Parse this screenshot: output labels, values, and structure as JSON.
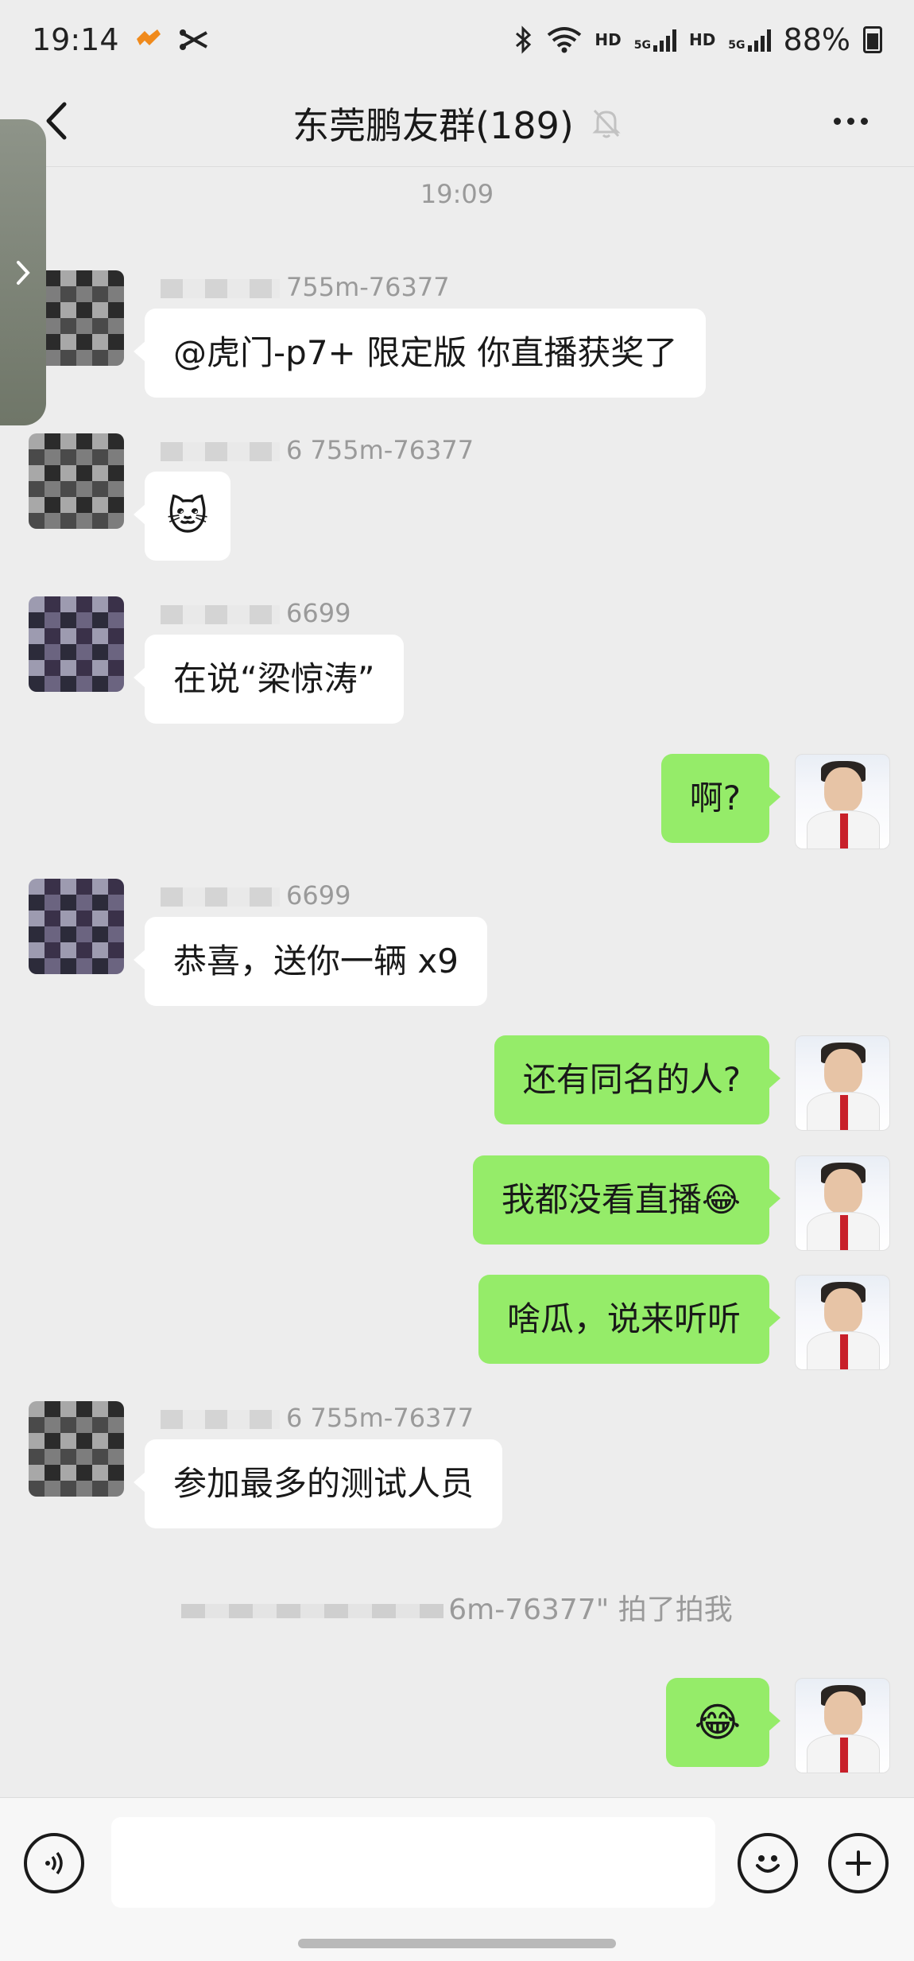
{
  "status_bar": {
    "time": "19:14",
    "network_1": "HD",
    "gen_1": "5G",
    "network_2": "HD",
    "gen_2": "5G",
    "battery": "88%",
    "icons": [
      "bluetooth-icon",
      "wifi-icon",
      "signal-icon",
      "battery-icon"
    ]
  },
  "header": {
    "title": "东莞鹏友群(189)",
    "back_icon": "chevron-left-icon",
    "mute_icon": "bell-off-icon",
    "more_icon": "more-icon"
  },
  "side_handle_icon": "chevron-right-icon",
  "timestamp": "19:09",
  "messages": [
    {
      "sender": "755m-76377",
      "text": "@虎门-p7+ 限定版  你直播获奖了",
      "direction": "in"
    },
    {
      "sender": "6 755m-76377",
      "text": "🐱",
      "direction": "in"
    },
    {
      "sender": "6699",
      "text": "在说“梁惊涛”",
      "direction": "in"
    },
    {
      "sender": "",
      "text": "啊?",
      "direction": "out"
    },
    {
      "sender": "6699",
      "text": "恭喜，送你一辆 x9",
      "direction": "in"
    },
    {
      "sender": "",
      "text": "还有同名的人?",
      "direction": "out"
    },
    {
      "sender": "",
      "text": "我都没看直播😂",
      "direction": "out"
    },
    {
      "sender": "",
      "text": "啥瓜，说来听听",
      "direction": "out"
    },
    {
      "sender": "6 755m-76377",
      "text": "参加最多的测试人员",
      "direction": "in"
    },
    {
      "sender": "",
      "text": "😂",
      "direction": "out"
    }
  ],
  "system_note": "6m-76377\" 拍了拍我",
  "input_bar": {
    "voice_icon": "voice-icon",
    "emoji_icon": "smiley-icon",
    "plus_icon": "plus-icon",
    "input_value": ""
  }
}
